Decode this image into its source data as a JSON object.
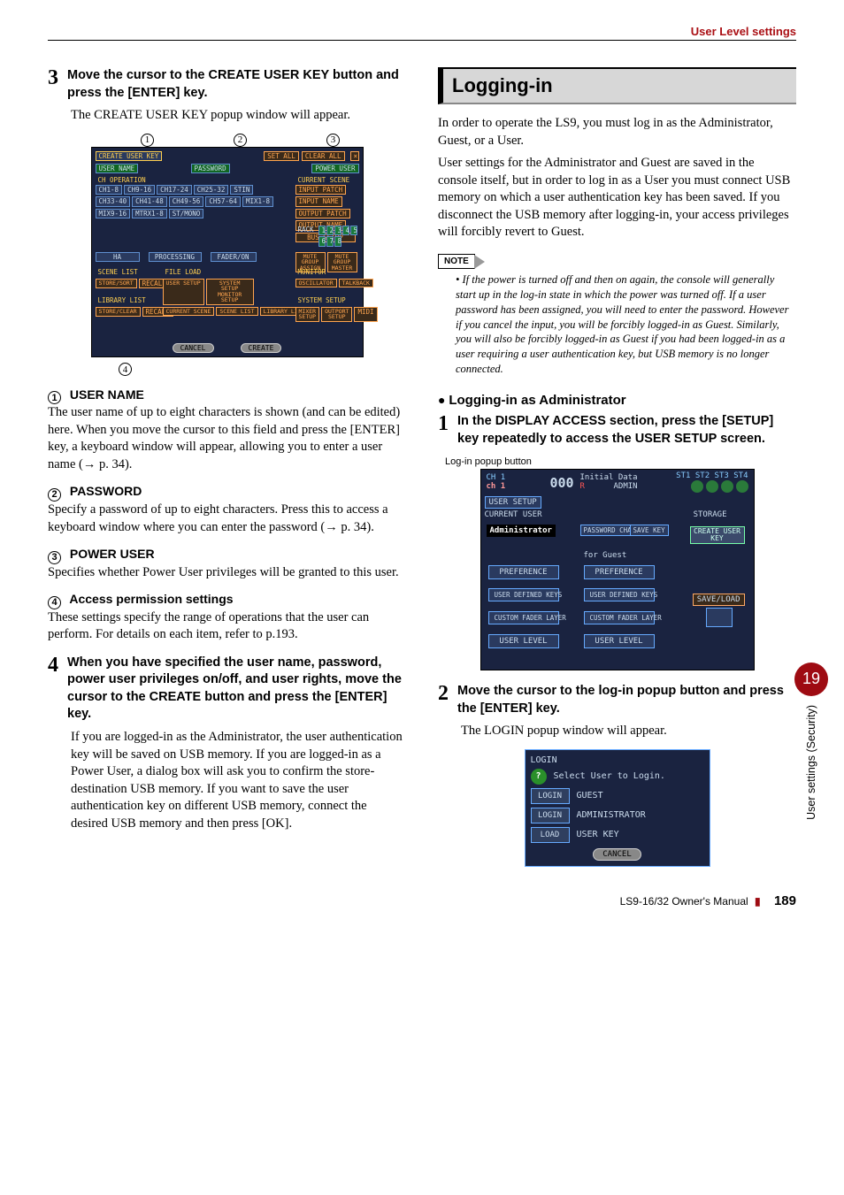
{
  "header": {
    "section_title": "User Level settings"
  },
  "col_left": {
    "step3": {
      "num": "3",
      "title": "Move the cursor to the CREATE USER KEY button and press the [ENTER] key.",
      "body": "The CREATE USER KEY popup window will appear."
    },
    "callouts_top": [
      "1",
      "2",
      "3"
    ],
    "callout_bottom": "4",
    "create_popup": {
      "title": "CREATE USER KEY",
      "set_all": "SET ALL",
      "clear_all": "CLEAR ALL",
      "user_name_lbl": "USER NAME",
      "password_lbl": "PASSWORD",
      "power_user_lbl": "POWER USER",
      "sections": {
        "ch_op": "CH OPERATION",
        "ch_rows": [
          "CH1-8",
          "CH9-16",
          "CH17-24",
          "CH25-32",
          "STIN",
          "CH33-40",
          "CH41-48",
          "CH49-56",
          "CH57-64",
          "MIX1-8",
          "MIX9-16",
          "MTRX1-8",
          "ST/MONO"
        ],
        "ha": "HA",
        "processing": "PROCESSING",
        "fader_on": "FADER/ON",
        "scene_list": "SCENE LIST",
        "store_sort": "STORE/SORT",
        "recall": "RECALL",
        "file_load": "FILE LOAD",
        "user_setup": "USER SETUP",
        "system_setup_mon": "SYSTEM SETUP MONITOR SETUP",
        "library_list": "LIBRARY LIST",
        "store_clear": "STORE/CLEAR",
        "current_scene": "CURRENT SCENE",
        "scene_list2": "SCENE LIST",
        "library_list2": "LIBRARY LIST",
        "input_patch": "INPUT PATCH",
        "input_name": "INPUT NAME",
        "output_patch": "OUTPUT PATCH",
        "output_name": "OUTPUT NAME",
        "bus_setup": "BUS SETUP",
        "rack": "RACK",
        "rack_nums": [
          "1",
          "2",
          "3",
          "4",
          "5",
          "6",
          "7",
          "8"
        ],
        "mute_assign": "MUTE GROUP ASSIGN",
        "mute_master": "MUTE GROUP MASTER",
        "monitor": "MONITOR",
        "oscillator": "OSCILLATOR",
        "talkback": "TALKBACK",
        "system_setup": "SYSTEM SETUP",
        "mixer_setup": "MIXER SETUP",
        "output_setup": "OUTPORT SETUP",
        "midi": "MIDI"
      },
      "cancel": "CANCEL",
      "create": "CREATE"
    },
    "items": {
      "i1_h": "USER NAME",
      "i1_b": "The user name of up to eight characters is shown (and can be edited) here. When you move the cursor to this field and press the [ENTER] key, a keyboard window will appear, allowing you to enter a user name (→ p. 34).",
      "i2_h": "PASSWORD",
      "i2_b": "Specify a password of up to eight characters. Press this to access a keyboard window where you can enter the password (→ p. 34).",
      "i3_h": "POWER USER",
      "i3_b": "Specifies whether Power User privileges will be granted to this user.",
      "i4_h": "Access permission settings",
      "i4_b": "These settings specify the range of operations that the user can perform. For details on each item, refer to p.193."
    },
    "step4": {
      "num": "4",
      "title": "When you have specified the user name, password, power user privileges on/off, and user rights, move the cursor to the CREATE button and press the [ENTER] key.",
      "body": "If you are logged-in as the Administrator, the user authentication key will be saved on USB memory. If you are logged-in as a Power User, a dialog box will ask you to confirm the store-destination USB memory. If you want to save the user authentication key on different USB memory, connect the desired USB memory and then press [OK]."
    }
  },
  "col_right": {
    "section": "Logging-in",
    "intro": "In order to operate the LS9, you must log in as the Administrator, Guest, or a User.",
    "intro2": "User settings for the Administrator and Guest are saved in the console itself, but in order to log in as a User you must connect USB memory on which a user authentication key has been saved. If you disconnect the USB memory after logging-in, your access privileges will forcibly revert to Guest.",
    "note_tag": "NOTE",
    "note_body": "• If the power is turned off and then on again, the console will generally start up in the log-in state in which the power was turned off. If a user password has been assigned, you will need to enter the password. However if you cancel the input, you will be forcibly logged-in as Guest. Similarly, you will also be forcibly logged-in as Guest if you had been logged-in as a user requiring a user authentication key, but USB memory is no longer connected.",
    "sub_bullet": "Logging-in as Administrator",
    "step1": {
      "num": "1",
      "title": "In the DISPLAY ACCESS section, press the [SETUP] key repeatedly to access the USER SETUP screen."
    },
    "fig_label": "Log-in popup button",
    "setup_screen": {
      "ch": "CH 1",
      "ch_lower": "ch 1",
      "scene_num": "000",
      "scene_name": "Initial Data",
      "r": "R",
      "admin": "ADMIN",
      "st": [
        "ST1",
        "ST2",
        "ST3",
        "ST4"
      ],
      "tab": "USER SETUP",
      "current_user": "CURRENT USER",
      "admin_field": "Administrator",
      "pwd_change": "PASSWORD CHANGE",
      "save_key": "SAVE KEY",
      "storage": "STORAGE",
      "create_user_key": "CREATE USER KEY",
      "for_guest": "for Guest",
      "preference": "PREFERENCE",
      "udk": "USER DEFINED KEYS",
      "cfl": "CUSTOM FADER LAYER",
      "ul": "USER LEVEL",
      "save_load": "SAVE/LOAD"
    },
    "step2": {
      "num": "2",
      "title": "Move the cursor to the log-in popup button and press the [ENTER] key.",
      "body": "The LOGIN popup window will appear."
    },
    "login_popup": {
      "title": "LOGIN",
      "prompt": "Select User to Login.",
      "login": "LOGIN",
      "guest": "GUEST",
      "administrator": "ADMINISTRATOR",
      "load": "LOAD",
      "user_key": "USER KEY",
      "cancel": "CANCEL"
    }
  },
  "side_tab": {
    "num": "19",
    "label": "User settings (Security)"
  },
  "footer": {
    "manual": "LS9-16/32  Owner's Manual",
    "page": "189"
  }
}
